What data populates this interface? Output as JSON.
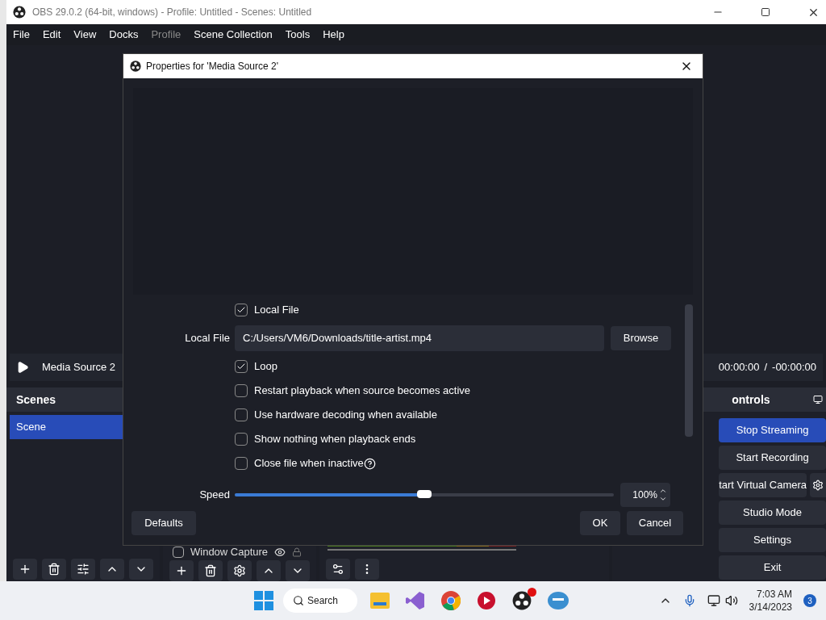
{
  "window": {
    "title": "OBS 29.0.2 (64-bit, windows) - Profile: Untitled - Scenes: Untitled"
  },
  "menu": [
    {
      "label": "File",
      "disabled": false
    },
    {
      "label": "Edit",
      "disabled": false
    },
    {
      "label": "View",
      "disabled": false
    },
    {
      "label": "Docks",
      "disabled": false
    },
    {
      "label": "Profile",
      "disabled": true
    },
    {
      "label": "Scene Collection",
      "disabled": false
    },
    {
      "label": "Tools",
      "disabled": false
    },
    {
      "label": "Help",
      "disabled": false
    }
  ],
  "media_bar": {
    "source": "Media Source 2",
    "time": "00:00:00",
    "separator": "/",
    "remaining": "-00:00:00"
  },
  "scenes": {
    "title": "Scenes",
    "items": [
      {
        "label": "Scene",
        "selected": true
      }
    ]
  },
  "sources": {
    "items": [
      {
        "label": "Window Capture",
        "checked": false
      }
    ]
  },
  "controls": {
    "title": "ontrols",
    "buttons": [
      {
        "label": "Stop Streaming",
        "active": true,
        "settings": false
      },
      {
        "label": "Start Recording",
        "active": false,
        "settings": false
      },
      {
        "label": "tart Virtual Camera",
        "active": false,
        "settings": true
      },
      {
        "label": "Studio Mode",
        "active": false,
        "settings": false
      },
      {
        "label": "Settings",
        "active": false,
        "settings": false
      },
      {
        "label": "Exit",
        "active": false,
        "settings": false
      }
    ]
  },
  "dialog": {
    "title": "Properties for 'Media Source 2'",
    "properties": [
      {
        "kind": "checkbox",
        "label": "Local File",
        "checked": true,
        "help": false
      },
      {
        "kind": "file",
        "label": "Local File",
        "value": "C:/Users/VM6/Downloads/title-artist.mp4",
        "button": "Browse"
      },
      {
        "kind": "checkbox",
        "label": "Loop",
        "checked": true,
        "help": false
      },
      {
        "kind": "checkbox",
        "label": "Restart playback when source becomes active",
        "checked": false,
        "help": false
      },
      {
        "kind": "checkbox",
        "label": "Use hardware decoding when available",
        "checked": false,
        "help": false
      },
      {
        "kind": "checkbox",
        "label": "Show nothing when playback ends",
        "checked": false,
        "help": false
      },
      {
        "kind": "checkbox",
        "label": "Close file when inactive",
        "checked": false,
        "help": true
      },
      {
        "kind": "slider",
        "label": "Speed",
        "level": 0.5,
        "value": "100%"
      }
    ],
    "buttons": {
      "defaults": "Defaults",
      "ok": "OK",
      "cancel": "Cancel"
    }
  },
  "taskbar": {
    "search": "Search",
    "time": "7:03 AM",
    "date": "3/14/2023",
    "notifications": "3"
  }
}
